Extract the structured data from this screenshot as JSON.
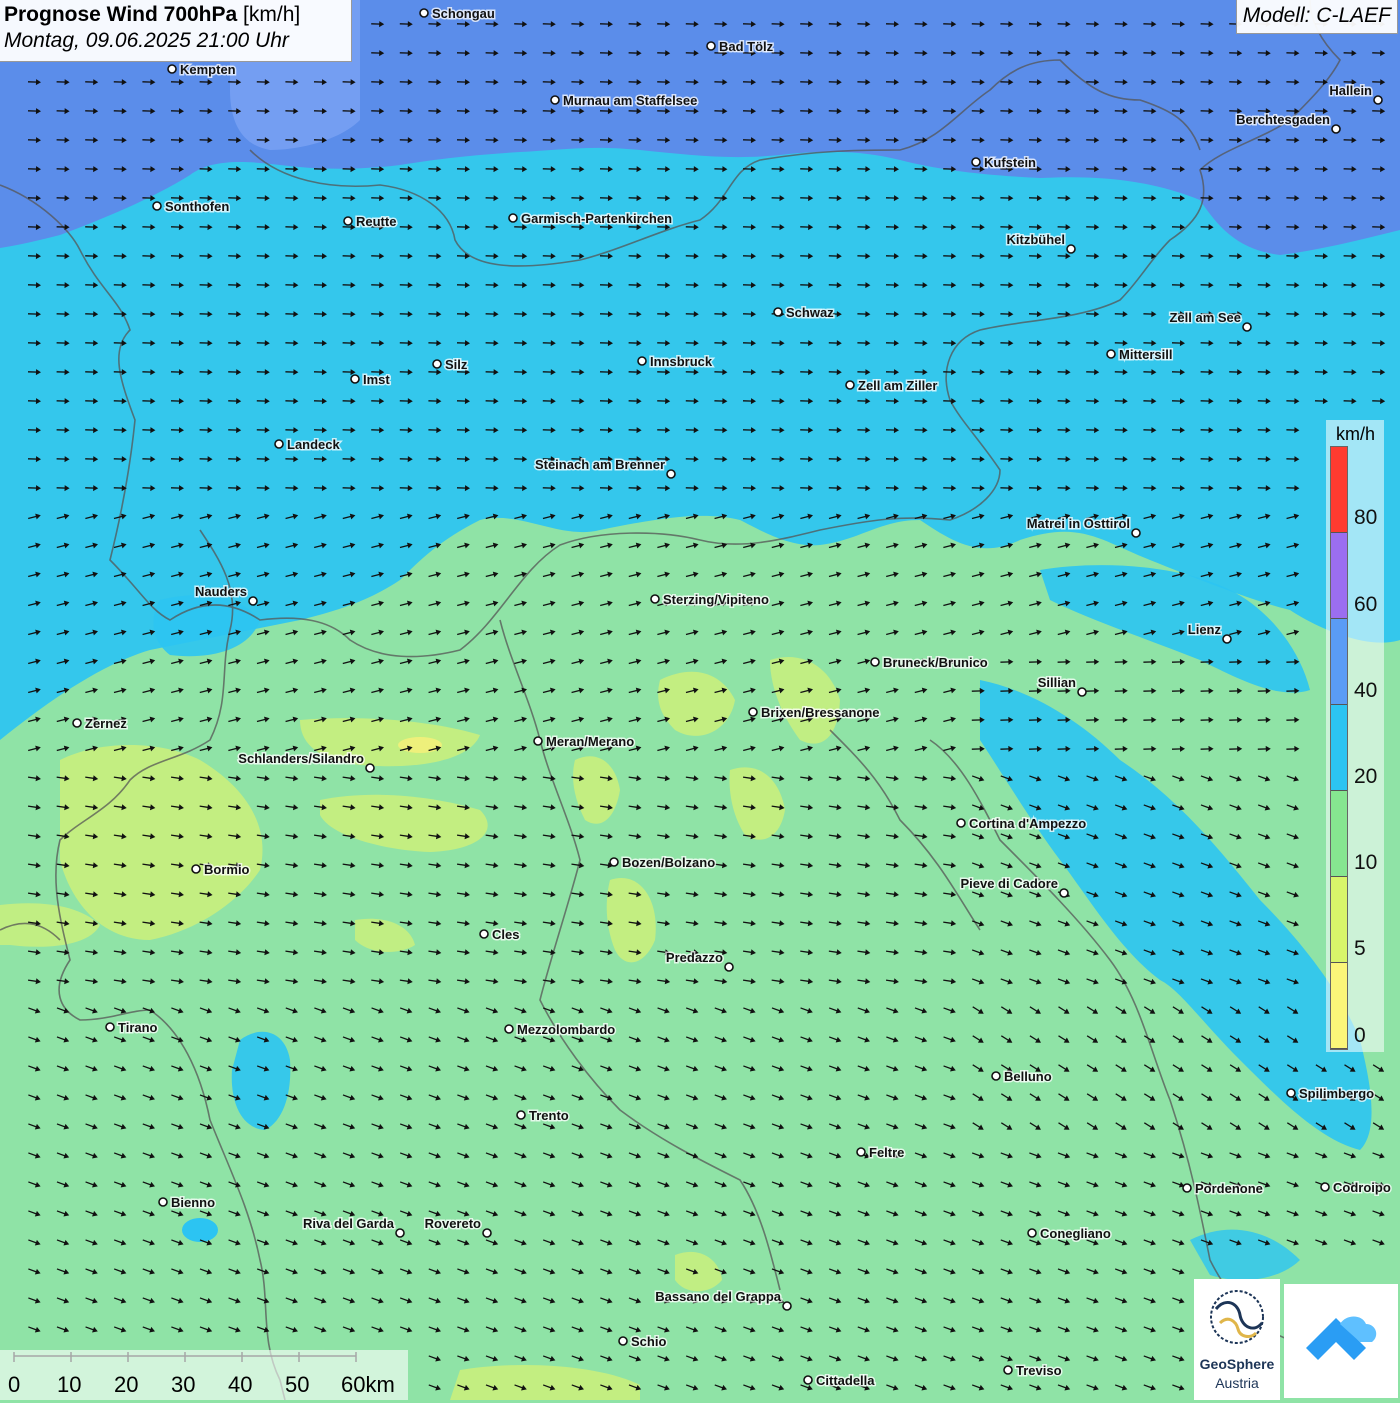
{
  "header": {
    "title_bold": "Prognose Wind 700hPa",
    "title_unit": "[km/h]",
    "datetime": "Montag, 09.06.2025 21:00 Uhr",
    "model": "Modell: C-LAEF"
  },
  "legend": {
    "unit": "km/h",
    "labels": [
      "80",
      "60",
      "40",
      "20",
      "10",
      "5",
      "0"
    ],
    "colors": [
      "#ff3b30",
      "#9b6ef0",
      "#5a9cf5",
      "#2cc4f2",
      "#86e690",
      "#d9f56a",
      "#fbf679"
    ]
  },
  "scale": {
    "labels": [
      "0",
      "10",
      "20",
      "30",
      "40",
      "50",
      "60km"
    ]
  },
  "logos": {
    "geosphere_line1": "GeoSphere",
    "geosphere_line2": "Austria"
  },
  "wind_field": {
    "north_band_kmh": "20-40",
    "central_band_kmh": "10-20",
    "south_band_kmh": "10-20",
    "patch_kmh": "5-10",
    "arrow_direction": "east to east-southeast"
  },
  "towns": [
    {
      "name": "Schongau"
    },
    {
      "name": "Bad Tölz"
    },
    {
      "name": "Kempten"
    },
    {
      "name": "Murnau am Staffelsee"
    },
    {
      "name": "Hallein"
    },
    {
      "name": "Berchtesgaden"
    },
    {
      "name": "Kufstein"
    },
    {
      "name": "Sonthofen"
    },
    {
      "name": "Reutte"
    },
    {
      "name": "Garmisch-Partenkirchen"
    },
    {
      "name": "Kitzbühel"
    },
    {
      "name": "Schwaz"
    },
    {
      "name": "Zell am See"
    },
    {
      "name": "Mittersill"
    },
    {
      "name": "Imst"
    },
    {
      "name": "Silz"
    },
    {
      "name": "Innsbruck"
    },
    {
      "name": "Zell am Ziller"
    },
    {
      "name": "Landeck"
    },
    {
      "name": "Steinach am Brenner"
    },
    {
      "name": "Matrei in Osttirol"
    },
    {
      "name": "Nauders"
    },
    {
      "name": "Sterzing/Vipiteno"
    },
    {
      "name": "Lienz"
    },
    {
      "name": "Bruneck/Brunico"
    },
    {
      "name": "Sillian"
    },
    {
      "name": "Zernez"
    },
    {
      "name": "Brixen/Bressanone"
    },
    {
      "name": "Meran/Merano"
    },
    {
      "name": "Schlanders/Silandro"
    },
    {
      "name": "Cortina d'Ampezzo"
    },
    {
      "name": "Bozen/Bolzano"
    },
    {
      "name": "Bormio"
    },
    {
      "name": "Pieve di Cadore"
    },
    {
      "name": "Cles"
    },
    {
      "name": "Predazzo"
    },
    {
      "name": "Tirano"
    },
    {
      "name": "Mezzolombardo"
    },
    {
      "name": "Belluno"
    },
    {
      "name": "Spilimbergo"
    },
    {
      "name": "Trento"
    },
    {
      "name": "Feltre"
    },
    {
      "name": "Pordenone"
    },
    {
      "name": "Codroipo"
    },
    {
      "name": "Bienno"
    },
    {
      "name": "Riva del Garda"
    },
    {
      "name": "Rovereto"
    },
    {
      "name": "Conegliano"
    },
    {
      "name": "Bassano del Grappa"
    },
    {
      "name": "Schio"
    },
    {
      "name": "Treviso"
    },
    {
      "name": "Cittadella"
    }
  ]
}
